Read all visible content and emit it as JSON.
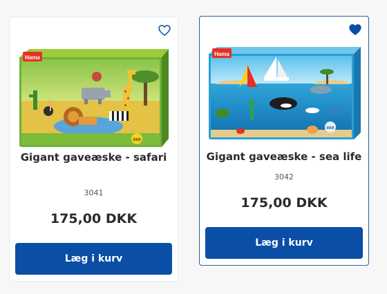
{
  "products": [
    {
      "title": "Gigant gaveæske - safari",
      "sku": "3041",
      "price": "175,00 DKK",
      "button_label": "Læg i kurv",
      "favorite_active": false,
      "box_brand": "Hama",
      "box_badge": "6000"
    },
    {
      "title": "Gigant gaveæske - sea life",
      "sku": "3042",
      "price": "175,00 DKK",
      "button_label": "Læg i kurv",
      "favorite_active": true,
      "box_brand": "Hama",
      "box_badge": "6000"
    }
  ],
  "colors": {
    "button": "#0a4ea6",
    "heart": "#0a4ea6",
    "selected_border": "#2b5c9e"
  },
  "icons": {
    "favorite_outline": "heart-outline-icon",
    "favorite_filled": "heart-filled-icon"
  }
}
